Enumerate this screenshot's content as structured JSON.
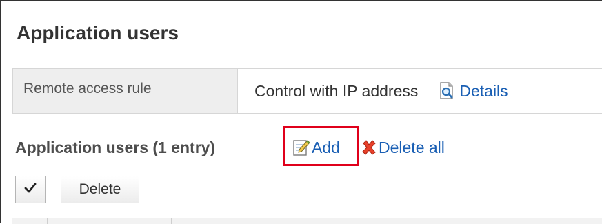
{
  "page": {
    "title": "Application users"
  },
  "remote_access": {
    "label": "Remote access rule",
    "value": "Control with IP address",
    "details_label": "Details",
    "details_icon": "magnifier-document-icon"
  },
  "list": {
    "heading": "Application users (1 entry)",
    "add_label": "Add",
    "add_icon": "edit-note-icon",
    "delete_all_label": "Delete all",
    "delete_all_icon": "red-x-icon"
  },
  "toolbar": {
    "check_icon": "checkmark-icon",
    "delete_label": "Delete"
  },
  "colors": {
    "link": "#1a5fb4",
    "highlight": "#e0001b",
    "delete_x": "#e8402a"
  }
}
